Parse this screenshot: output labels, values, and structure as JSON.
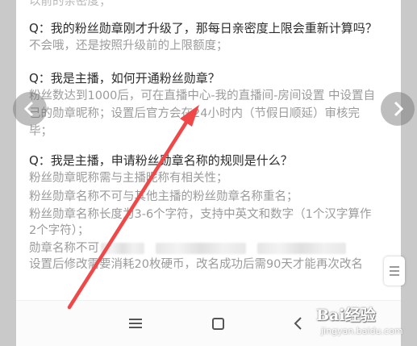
{
  "article": {
    "top_partial": "以前的亲密度；",
    "faq": [
      {
        "question": "Q：我的粉丝勋章刚才升级了，那每日亲密度上限会重新计算吗？",
        "answer": [
          "不会哦，还是按照升级前的上限额度；"
        ]
      },
      {
        "question": "Q：我是主播，如何开通粉丝勋章？",
        "answer": [
          "粉丝数达到1000后，可在直播中心-我的直播间-房间设置 中设置自",
          "己的勋章昵称；设置后官方会在24小时内（节假日顺延）审核完",
          "毕；"
        ]
      },
      {
        "question": "Q：我是主播，申请粉丝勋章名称的规则是什么？",
        "answer": [
          "粉丝勋章昵称需与主播昵称有相关性；",
          "粉丝勋章名称不可与其他主播的粉丝勋章名称重名；",
          "粉丝勋章名称长度为3-6个字符，支持中英文和数字（1个汉字算作",
          "2个字符）；",
          "勋章名称不可",
          "设置后修改需要消耗20枚硬币，改名成功后需90天才能再次改名"
        ]
      }
    ]
  },
  "navigation": {
    "menu_icon": "menu-icon",
    "home_icon": "home-icon",
    "back_icon": "back-icon"
  },
  "viewer": {
    "prev_icon": "chevron-left-icon",
    "next_icon": "chevron-right-icon",
    "scroll_icon": "scroll-handle-icon"
  },
  "watermark": {
    "brand": "Bai经验",
    "url": "jingyan.baidu.com"
  },
  "colors": {
    "question_text": "#2b2b2b",
    "answer_text": "#9b9b9b",
    "annotation_arrow": "#f04848",
    "page_background": "#c9c9c9"
  }
}
